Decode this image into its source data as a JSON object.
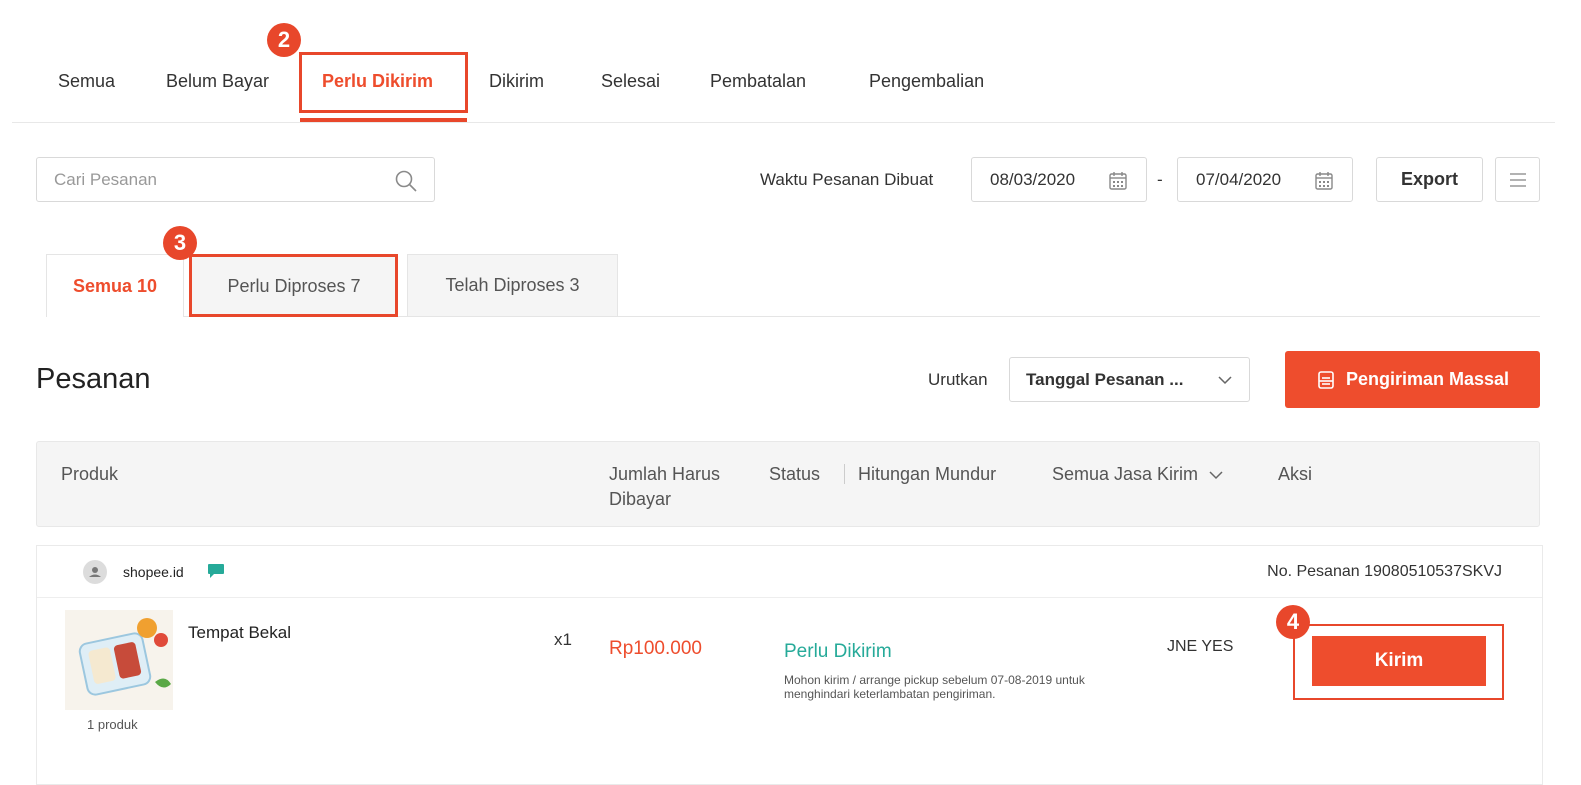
{
  "top_tabs": [
    "Semua",
    "Belum Bayar",
    "Perlu Dikirim",
    "Dikirim",
    "Selesai",
    "Pembatalan",
    "Pengembalian"
  ],
  "markers": [
    "2",
    "3",
    "4"
  ],
  "search": {
    "placeholder": "Cari Pesanan"
  },
  "date_filter": {
    "label": "Waktu Pesanan Dibuat",
    "from": "08/03/2020",
    "separator": "-",
    "to": "07/04/2020"
  },
  "export_label": "Export",
  "sub_tabs": [
    "Semua 10",
    "Perlu Diproses 7",
    "Telah Diproses 3"
  ],
  "section_title": "Pesanan",
  "sort": {
    "label": "Urutkan",
    "value": "Tanggal Pesanan ..."
  },
  "bulk_ship_label": "Pengiriman Massal",
  "table_headers": {
    "product": "Produk",
    "amount_line1": "Jumlah Harus",
    "amount_line2": "Dibayar",
    "status": "Status",
    "countdown": "Hitungan Mundur",
    "courier": "Semua Jasa Kirim",
    "action": "Aksi"
  },
  "order": {
    "shop": "shopee.id",
    "order_no": "No. Pesanan 19080510537SKVJ",
    "product_name": "Tempat Bekal",
    "qty": "x1",
    "product_count": "1 produk",
    "price": "Rp100.000",
    "status": "Perlu Dikirim",
    "status_note": "Mohon kirim / arrange pickup sebelum 07-08-2019 untuk menghindari keterlambatan pengiriman.",
    "courier": "JNE YES",
    "action_label": "Kirim"
  },
  "colors": {
    "accent": "#ee4d2d",
    "status_green": "#26aa99",
    "marker": "#e8472b"
  }
}
